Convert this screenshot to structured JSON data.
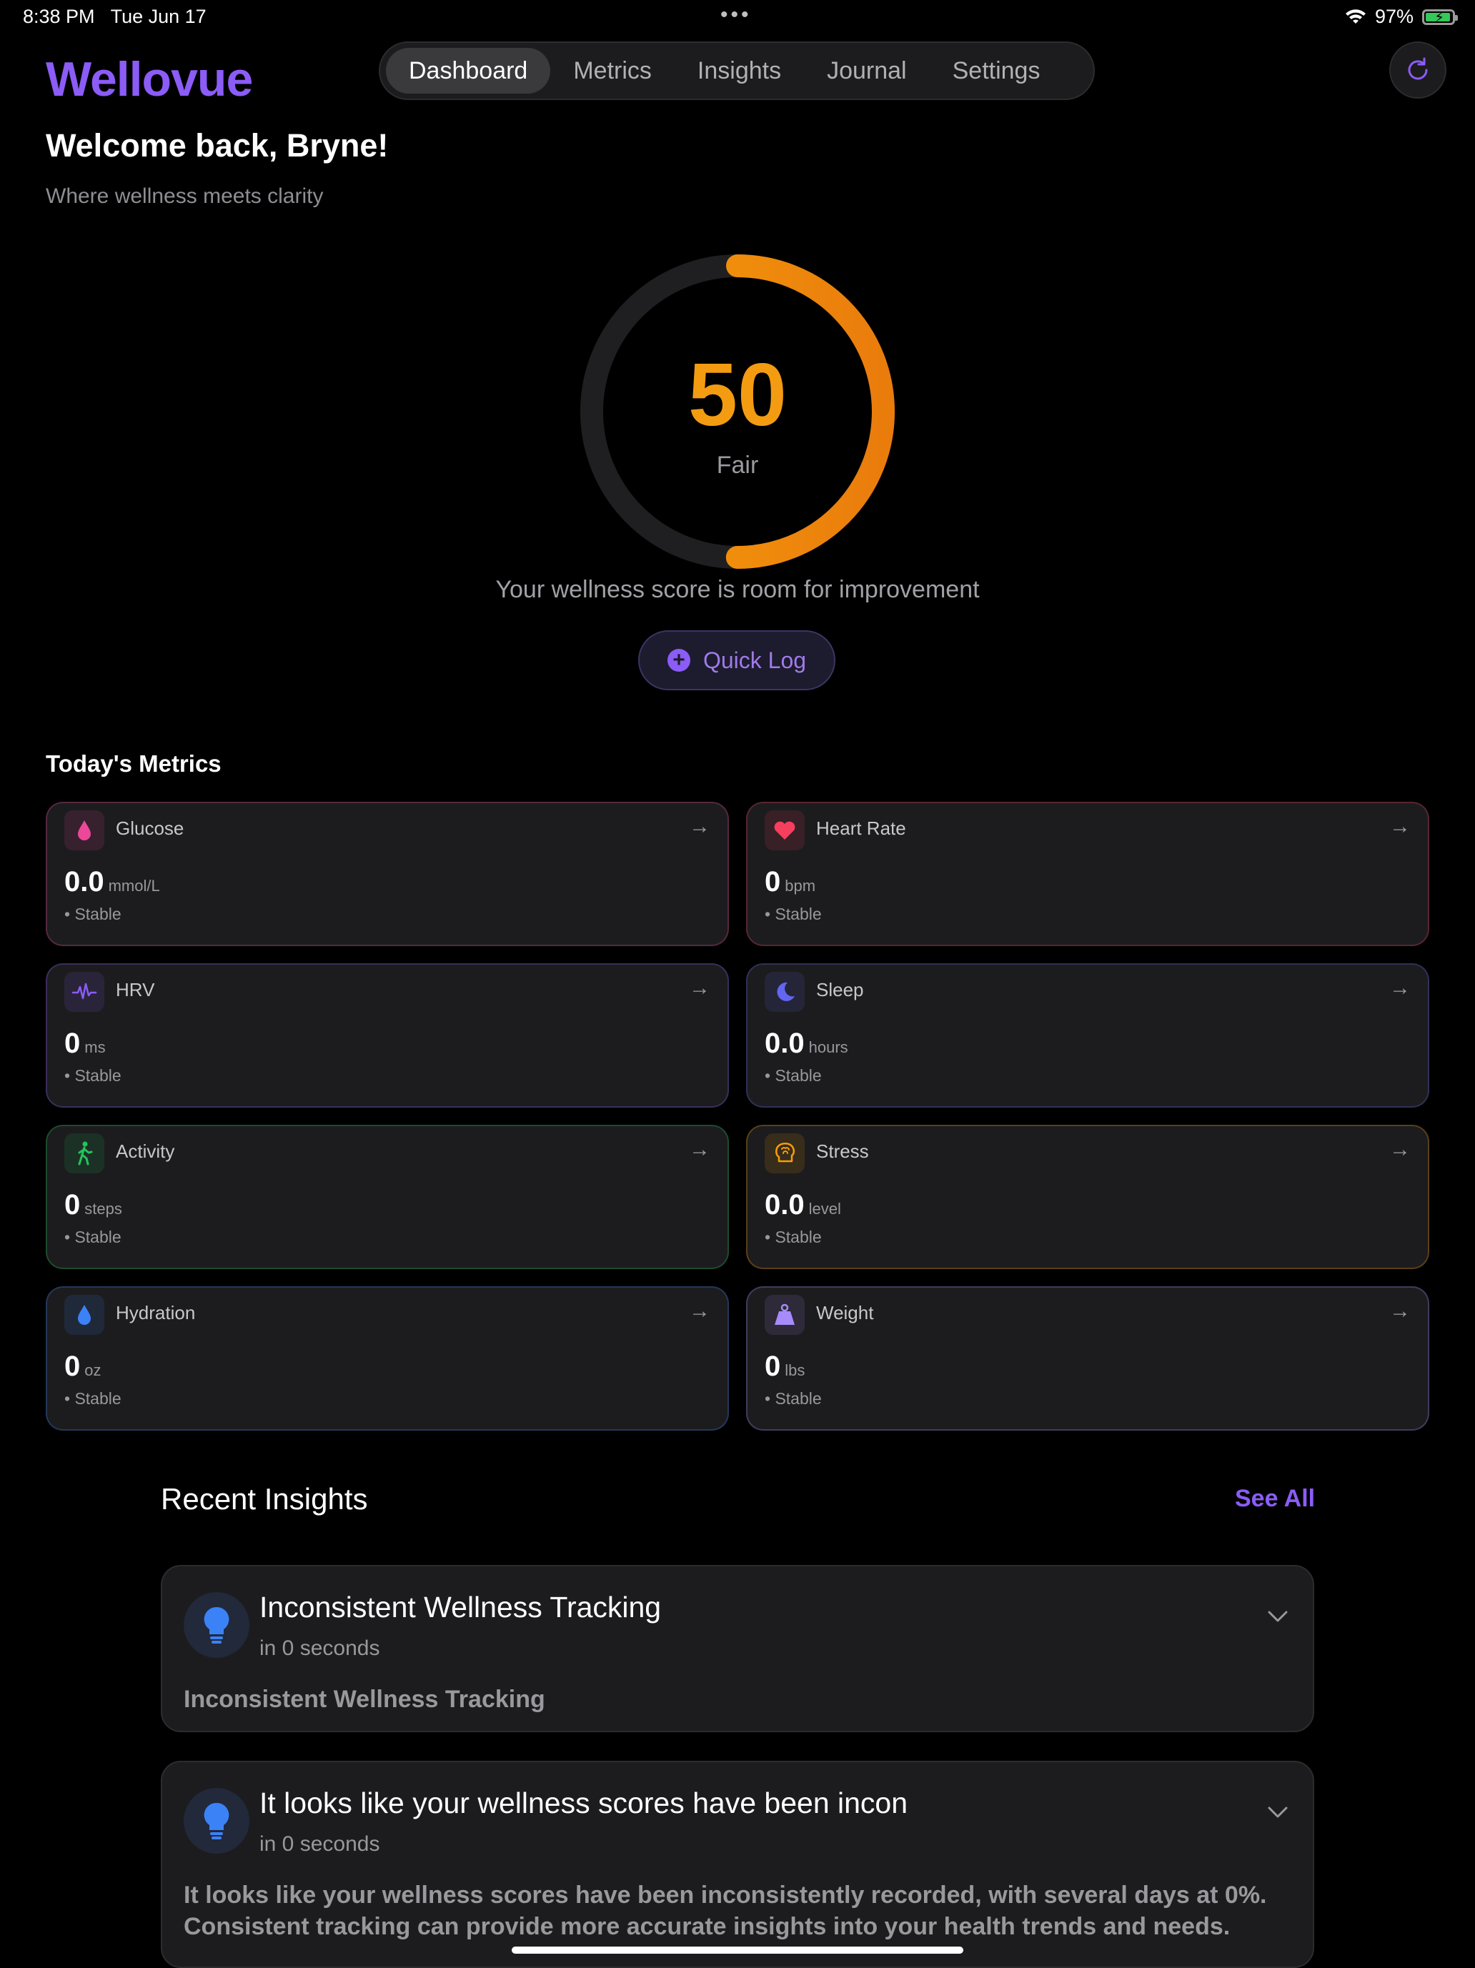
{
  "status_bar": {
    "time": "8:38 PM",
    "date": "Tue Jun 17",
    "dots": "•••",
    "battery_percent": "97%"
  },
  "header": {
    "logo": "Wellovue",
    "tabs": [
      "Dashboard",
      "Metrics",
      "Insights",
      "Journal",
      "Settings"
    ],
    "active_tab": "Dashboard",
    "refresh_icon": "refresh-icon"
  },
  "welcome": {
    "title": "Welcome back, Bryne!",
    "tagline": "Where wellness meets clarity"
  },
  "score": {
    "value": "50",
    "progress_fraction": 0.5,
    "label": "Fair",
    "message": "Your wellness score is room for improvement",
    "accent_color": "#f39c12"
  },
  "quick_log": {
    "label": "Quick Log"
  },
  "metrics": {
    "title": "Today's Metrics",
    "items": [
      {
        "name": "Glucose",
        "value": "0.0",
        "unit": "mmol/L",
        "trend": "• Stable",
        "icon": "drop-icon",
        "color": "#ec4899"
      },
      {
        "name": "Heart Rate",
        "value": "0",
        "unit": "bpm",
        "trend": "• Stable",
        "icon": "heart-icon",
        "color": "#f43f5e"
      },
      {
        "name": "HRV",
        "value": "0",
        "unit": "ms",
        "trend": "• Stable",
        "icon": "waveform-icon",
        "color": "#8b5cf6"
      },
      {
        "name": "Sleep",
        "value": "0.0",
        "unit": "hours",
        "trend": "• Stable",
        "icon": "moon-icon",
        "color": "#6366f1"
      },
      {
        "name": "Activity",
        "value": "0",
        "unit": "steps",
        "trend": "• Stable",
        "icon": "walking-icon",
        "color": "#22c55e"
      },
      {
        "name": "Stress",
        "value": "0.0",
        "unit": "level",
        "trend": "• Stable",
        "icon": "brain-icon",
        "color": "#f59e0b"
      },
      {
        "name": "Hydration",
        "value": "0",
        "unit": "oz",
        "trend": "• Stable",
        "icon": "water-drop-icon",
        "color": "#3b82f6"
      },
      {
        "name": "Weight",
        "value": "0",
        "unit": "lbs",
        "trend": "• Stable",
        "icon": "weight-icon",
        "color": "#a78bfa"
      }
    ]
  },
  "insights": {
    "title": "Recent Insights",
    "see_all": "See All",
    "items": [
      {
        "title": "Inconsistent Wellness Tracking",
        "time": "in 0 seconds",
        "body": "Inconsistent Wellness Tracking"
      },
      {
        "title": "It looks like your wellness scores have been incon",
        "time": "in 0 seconds",
        "body": "It looks like your wellness scores have been inconsistently recorded, with several days at 0%. Consistent tracking can provide more accurate insights into your health trends and needs."
      }
    ]
  }
}
